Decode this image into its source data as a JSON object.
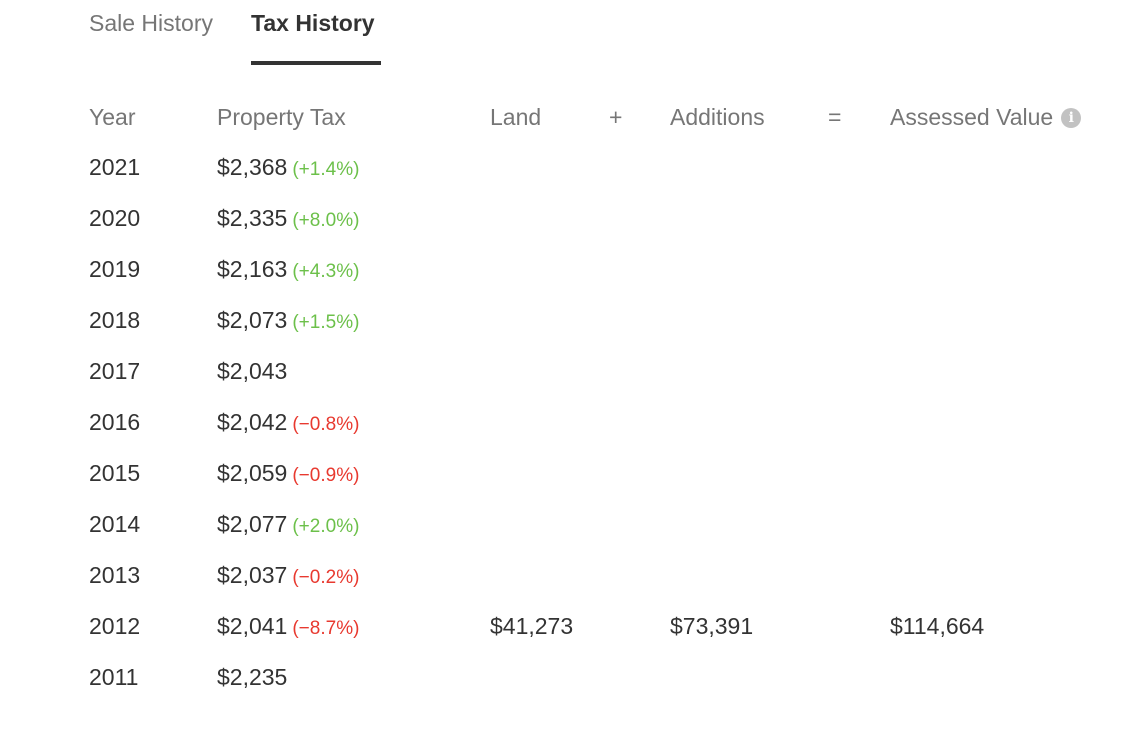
{
  "tabs": [
    {
      "label": "Sale History",
      "active": false
    },
    {
      "label": "Tax History",
      "active": true
    }
  ],
  "table": {
    "headers": {
      "year": "Year",
      "property_tax": "Property Tax",
      "land": "Land",
      "plus": "+",
      "additions": "Additions",
      "equals": "=",
      "assessed_value": "Assessed Value",
      "info_icon": "info-icon"
    },
    "rows": [
      {
        "year": "2021",
        "tax": "$2,368",
        "change": "(+1.4%)",
        "direction": "up",
        "land": "",
        "additions": "",
        "assessed": ""
      },
      {
        "year": "2020",
        "tax": "$2,335",
        "change": "(+8.0%)",
        "direction": "up",
        "land": "",
        "additions": "",
        "assessed": ""
      },
      {
        "year": "2019",
        "tax": "$2,163",
        "change": "(+4.3%)",
        "direction": "up",
        "land": "",
        "additions": "",
        "assessed": ""
      },
      {
        "year": "2018",
        "tax": "$2,073",
        "change": "(+1.5%)",
        "direction": "up",
        "land": "",
        "additions": "",
        "assessed": ""
      },
      {
        "year": "2017",
        "tax": "$2,043",
        "change": "",
        "direction": "",
        "land": "",
        "additions": "",
        "assessed": ""
      },
      {
        "year": "2016",
        "tax": "$2,042",
        "change": "(−0.8%)",
        "direction": "down",
        "land": "",
        "additions": "",
        "assessed": ""
      },
      {
        "year": "2015",
        "tax": "$2,059",
        "change": "(−0.9%)",
        "direction": "down",
        "land": "",
        "additions": "",
        "assessed": ""
      },
      {
        "year": "2014",
        "tax": "$2,077",
        "change": "(+2.0%)",
        "direction": "up",
        "land": "",
        "additions": "",
        "assessed": ""
      },
      {
        "year": "2013",
        "tax": "$2,037",
        "change": "(−0.2%)",
        "direction": "down",
        "land": "",
        "additions": "",
        "assessed": ""
      },
      {
        "year": "2012",
        "tax": "$2,041",
        "change": "(−8.7%)",
        "direction": "down",
        "land": "$41,273",
        "additions": "$73,391",
        "assessed": "$114,664"
      },
      {
        "year": "2011",
        "tax": "$2,235",
        "change": "",
        "direction": "",
        "land": "",
        "additions": "",
        "assessed": ""
      }
    ]
  },
  "colors": {
    "increase": "#6cc04a",
    "decrease": "#e8392f",
    "text": "#333333",
    "muted": "#767676"
  }
}
